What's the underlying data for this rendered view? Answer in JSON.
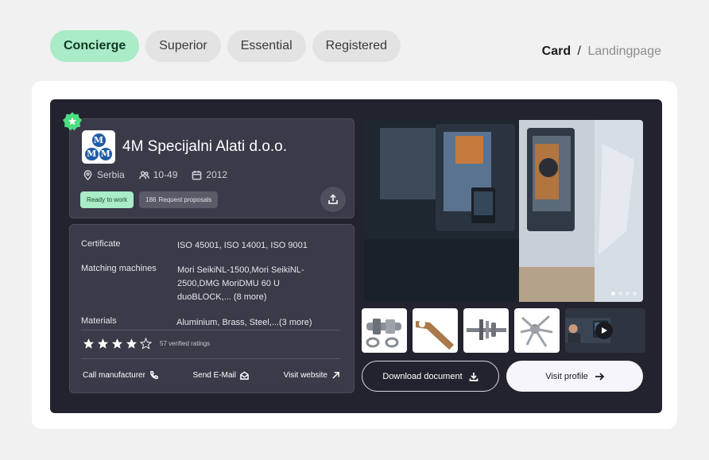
{
  "tabs": [
    {
      "label": "Concierge",
      "active": true
    },
    {
      "label": "Superior",
      "active": false
    },
    {
      "label": "Essential",
      "active": false
    },
    {
      "label": "Registered",
      "active": false
    }
  ],
  "breadcrumb": {
    "current": "Card",
    "separator": "/",
    "link": "Landingpage"
  },
  "company": {
    "logo_text": [
      "M",
      "M",
      "M"
    ],
    "name": "4M Specijalni Alati d.o.o.",
    "country": "Serbia",
    "employees": "10-49",
    "founded": "2012",
    "status_badge": "Ready to work",
    "proposals_count": "186",
    "proposals_label": "Request proposals"
  },
  "details": {
    "certificate_label": "Certificate",
    "certificate_value": "ISO 45001, ISO 14001, ISO 9001",
    "machines_label": "Matching machines",
    "machines_value": "Mori SeikiNL-1500,Mori SeikiNL-2500,DMG MoriDMU 60 U duoBLOCK,... (8 more)",
    "materials_label": "Materials",
    "materials_value": "Aluminium, Brass, Steel,...(3 more)"
  },
  "rating": {
    "value": 4,
    "max": 5,
    "text": "57 verified ratings"
  },
  "actions": {
    "call": "Call manufacturer",
    "email": "Send E-Mail",
    "website": "Visit website"
  },
  "gallery": {
    "slide_count": 4,
    "active_slide": 0
  },
  "buttons": {
    "download": "Download document",
    "profile": "Visit profile"
  },
  "colors": {
    "accent": "#a9ecc7",
    "card": "#23232f",
    "panel": "#3a3a48",
    "star": "#ffffff"
  }
}
